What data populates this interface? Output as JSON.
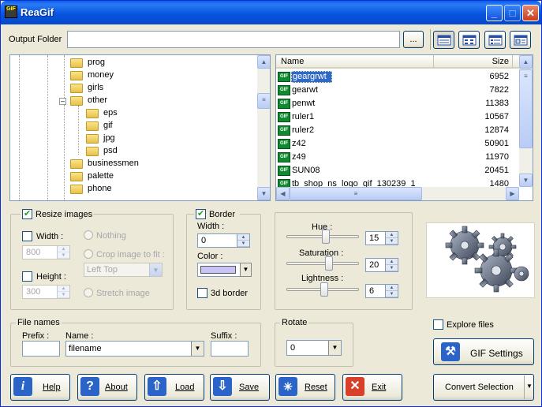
{
  "window": {
    "title": "ReaGif"
  },
  "output": {
    "label": "Output Folder",
    "value": "",
    "browse_label": "..."
  },
  "tree": {
    "items": [
      {
        "label": "prog",
        "level": 1
      },
      {
        "label": "money",
        "level": 1
      },
      {
        "label": "girls",
        "level": 1
      },
      {
        "label": "other",
        "level": 1
      },
      {
        "label": "eps",
        "level": 2
      },
      {
        "label": "gif",
        "level": 2
      },
      {
        "label": "jpg",
        "level": 2
      },
      {
        "label": "psd",
        "level": 2
      },
      {
        "label": "businessmen",
        "level": 1
      },
      {
        "label": "palette",
        "level": 1
      },
      {
        "label": "phone",
        "level": 1
      }
    ]
  },
  "files": {
    "headers": {
      "name": "Name",
      "size": "Size"
    },
    "rows": [
      {
        "name": "geargrwt",
        "size": "6952",
        "selected": true
      },
      {
        "name": "gearwt",
        "size": "7822"
      },
      {
        "name": "penwt",
        "size": "11383"
      },
      {
        "name": "ruler1",
        "size": "10567"
      },
      {
        "name": "ruler2",
        "size": "12874"
      },
      {
        "name": "z42",
        "size": "50901"
      },
      {
        "name": "z49",
        "size": "11970"
      },
      {
        "name": "SUN08",
        "size": "20451"
      },
      {
        "name": "tb_shop_ns_logo_gif_130239_1",
        "size": "1480"
      }
    ]
  },
  "resize": {
    "title": "Resize images",
    "width_label": "Width :",
    "width_value": "800",
    "height_label": "Height :",
    "height_value": "300",
    "opt_nothing": "Nothing",
    "opt_crop": "Crop image to fit :",
    "crop_value": "Left Top",
    "opt_stretch": "Stretch image"
  },
  "border": {
    "title": "Border",
    "width_label": "Width :",
    "width_value": "0",
    "color_label": "Color :",
    "color": "#c8c4f5",
    "border3d_label": "3d border"
  },
  "adjust": {
    "hue_label": "Hue :",
    "hue_value": "15",
    "hue_level": 0.55,
    "sat_label": "Saturation :",
    "sat_value": "20",
    "sat_level": 0.6,
    "light_label": "Lightness :",
    "light_value": "6",
    "light_level": 0.52
  },
  "filenames": {
    "title": "File names",
    "prefix_label": "Prefix :",
    "prefix_value": "",
    "name_label": "Name :",
    "name_value": "filename",
    "suffix_label": "Suffix :",
    "suffix_value": ""
  },
  "rotate": {
    "title": "Rotate",
    "value": "0"
  },
  "explore": {
    "label": "Explore files"
  },
  "buttons": {
    "help": "Help",
    "about": "About",
    "load": "Load",
    "save": "Save",
    "reset": "Reset",
    "exit": "Exit",
    "gif_settings": "GIF Settings",
    "convert": "Convert Selection"
  },
  "colors": {
    "title_bar": "#0a5fe6",
    "selection": "#316ac5"
  }
}
